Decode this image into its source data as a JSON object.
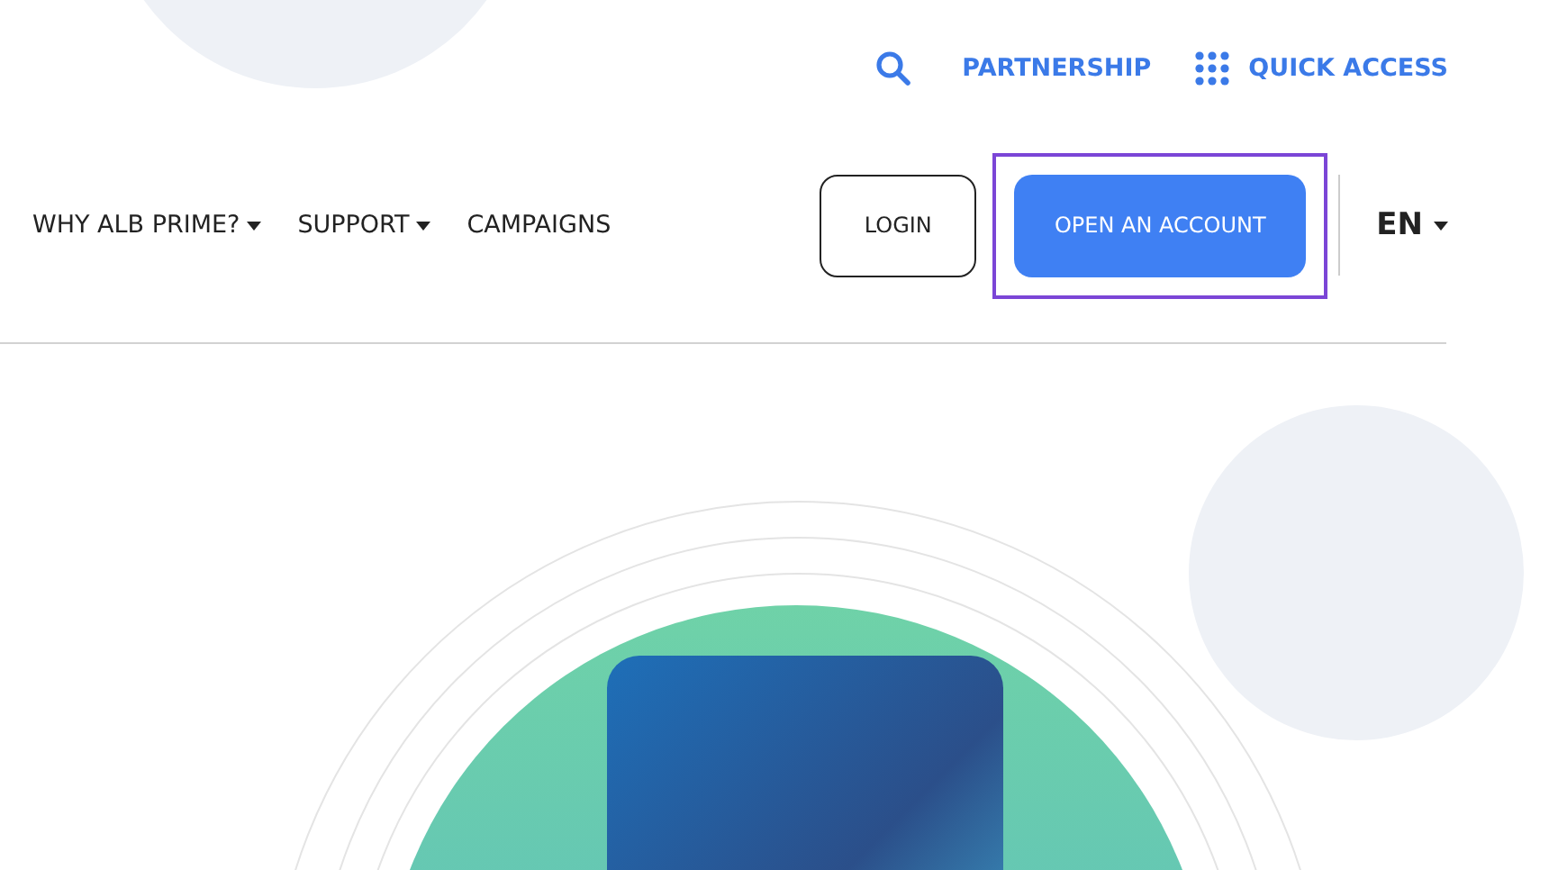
{
  "top_links": [
    {
      "kind": "search"
    },
    {
      "kind": "link",
      "label": "PARTNERSHIP"
    },
    {
      "kind": "grid",
      "label": "QUICK ACCESS"
    }
  ],
  "nav_items": [
    {
      "label": "WHY ALB PRIME?",
      "dropdown": true
    },
    {
      "label": "SUPPORT",
      "dropdown": true
    },
    {
      "label": "CAMPAIGNS",
      "dropdown": false
    }
  ],
  "login_button": "LOGIN",
  "account_button": {
    "label": "OPEN AN ACCOUNT",
    "highlighted": true
  },
  "language": "EN"
}
